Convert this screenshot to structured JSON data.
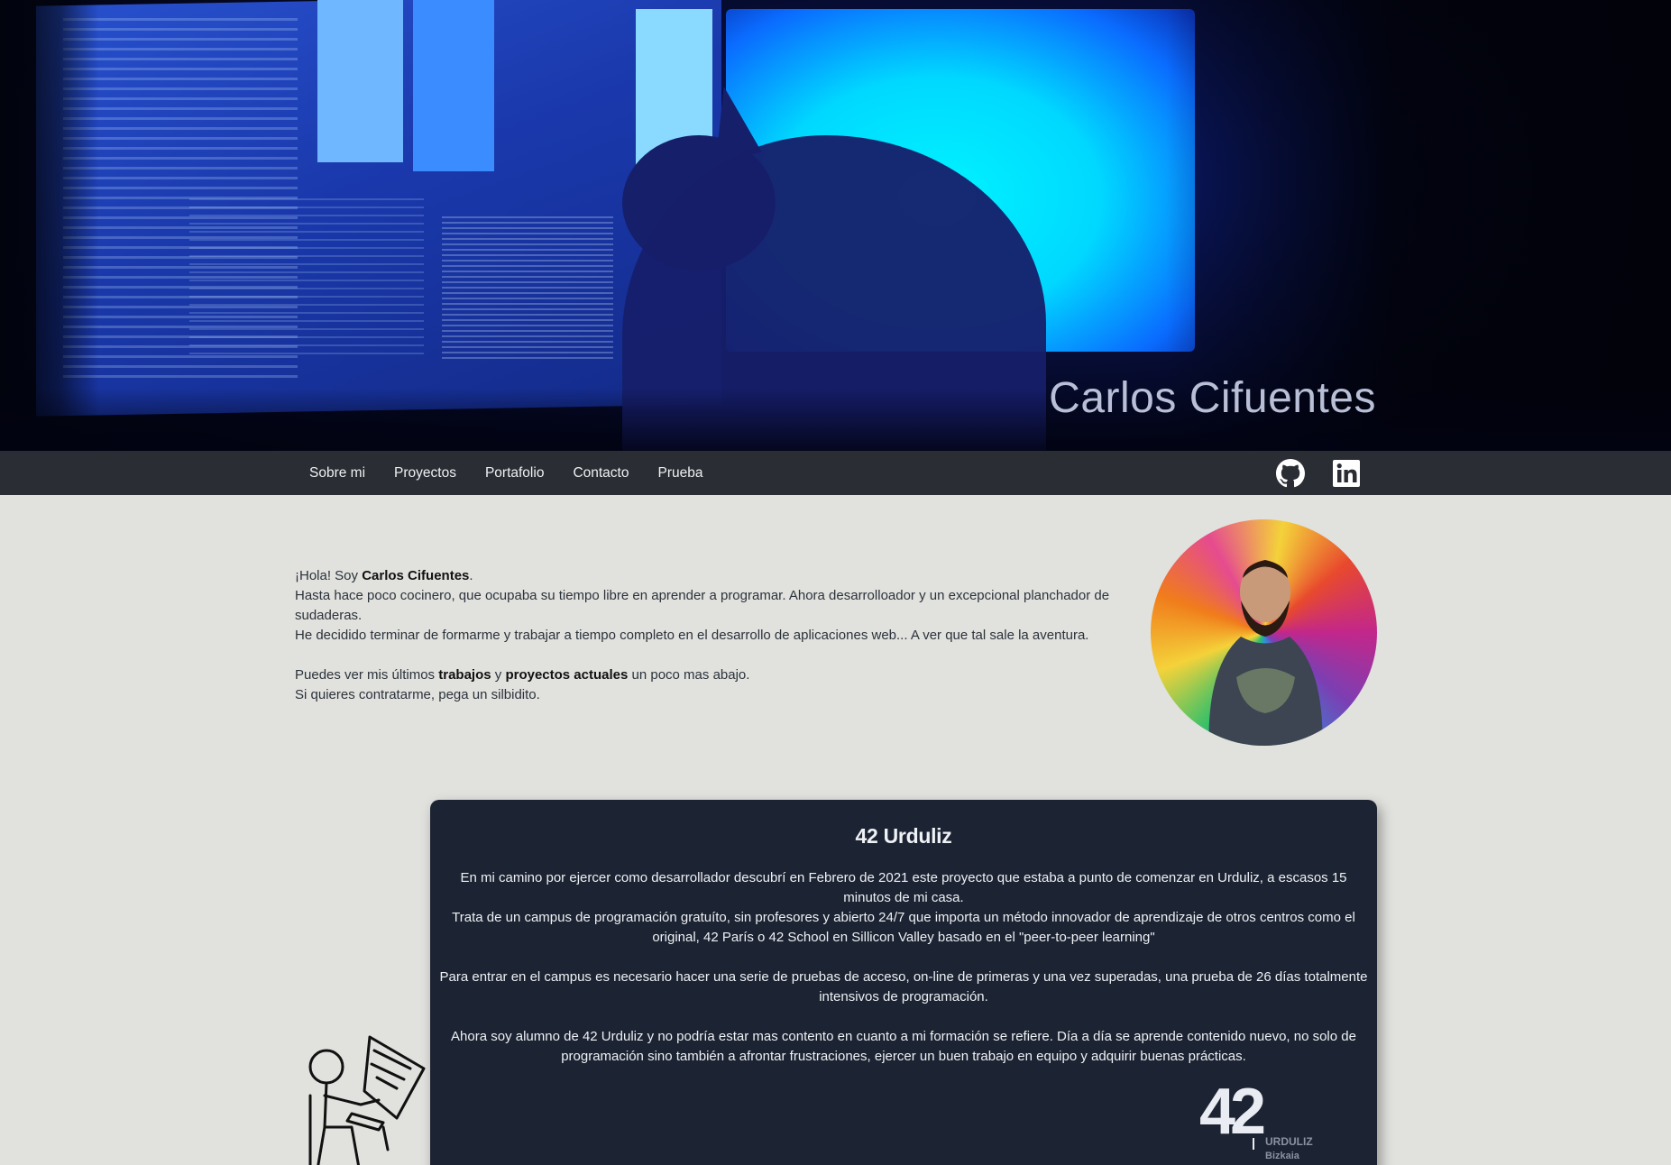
{
  "hero": {
    "title": "Carlos Cifuentes"
  },
  "nav": {
    "links": [
      "Sobre mi",
      "Proyectos",
      "Portafolio",
      "Contacto",
      "Prueba"
    ],
    "icons": [
      "github-icon",
      "linkedin-icon"
    ]
  },
  "intro": {
    "greeting_pre": "¡Hola! Soy ",
    "greeting_name": "Carlos Cifuentes",
    "greeting_post": ".",
    "line2": "Hasta hace poco cocinero, que ocupaba su tiempo libre en aprender a programar. Ahora desarrolloador y un excepcional planchador de sudaderas.",
    "line3": "He decidido terminar de formarme y trabajar a tiempo completo en el desarrollo de aplicaciones web... A ver que tal sale la aventura.",
    "line4_pre": "Puedes ver mis últimos ",
    "line4_b1": "trabajos",
    "line4_mid": " y ",
    "line4_b2": "proyectos actuales",
    "line4_post": " un poco mas abajo.",
    "line5": "Si quieres contratarme, pega un silbidito."
  },
  "card": {
    "title": "42 Urduliz",
    "p1": "En mi camino por ejercer como desarrollador descubrí en Febrero de 2021 este proyecto que estaba a punto de comenzar en Urduliz, a escasos 15 minutos de mi casa.",
    "p2": "Trata de un campus de programación gratuíto, sin profesores y abierto 24/7 que importa un método innovador de aprendizaje de otros centros como el original, 42 París o 42 School en Sillicon Valley basado en el \"peer-to-peer learning\"",
    "p3": "Para entrar en el campus es necesario hacer una serie de pruebas de acceso, on-line de primeras y una vez superadas, una prueba de 26 días totalmente intensivos de programación.",
    "p4": "Ahora soy alumno de 42 Urduliz y no podría estar mas contento en cuanto a mi formación se refiere. Día a día se aprende contenido nuevo, no solo de programación sino también a afrontar frustraciones, ejercer un buen trabajo en equipo y adquirir buenas prácticas.",
    "logo_text": "42",
    "logo_sub1": "URDULIZ",
    "logo_sub2": "Bizkaia"
  }
}
